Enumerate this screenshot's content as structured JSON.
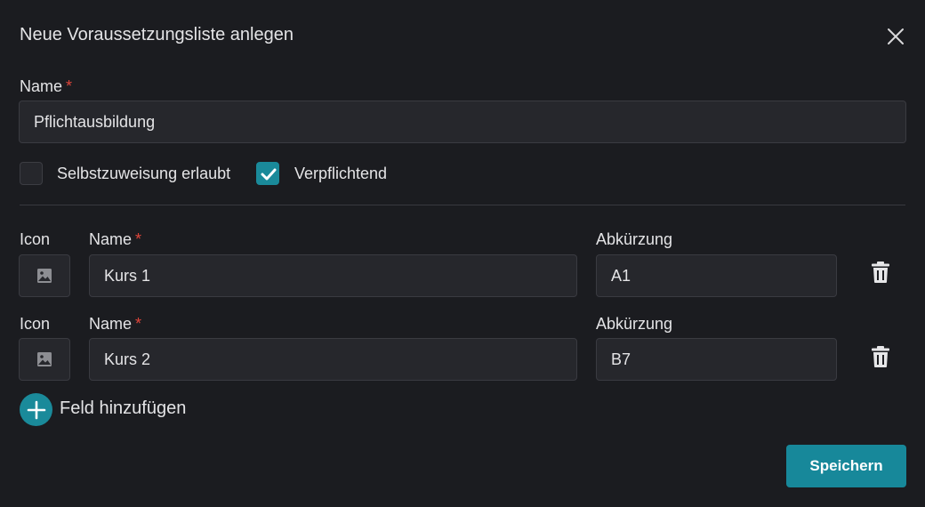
{
  "dialog": {
    "title": "Neue Voraussetzungsliste anlegen"
  },
  "form": {
    "name_label": "Name",
    "required_mark": "*",
    "name_value": "Pflichtausbildung",
    "self_assign_label": "Selbstzuweisung erlaubt",
    "self_assign_checked": false,
    "mandatory_label": "Verpflichtend",
    "mandatory_checked": true
  },
  "fields": [
    {
      "icon_label": "Icon",
      "name_label": "Name",
      "name_value": "Kurs 1",
      "abbr_label": "Abkürzung",
      "abbr_value": "A1"
    },
    {
      "icon_label": "Icon",
      "name_label": "Name",
      "name_value": "Kurs 2",
      "abbr_label": "Abkürzung",
      "abbr_value": "B7"
    }
  ],
  "actions": {
    "add_field_label": "Feld hinzufügen",
    "save_label": "Speichern"
  },
  "icons": {
    "close": "close-icon",
    "image": "image-icon",
    "trash": "trash-icon",
    "plus": "plus-icon",
    "check": "check-icon"
  },
  "colors": {
    "accent": "#1a8a9a",
    "required": "#e0453a",
    "background": "#1b1c20",
    "input_bg": "#26272c"
  }
}
